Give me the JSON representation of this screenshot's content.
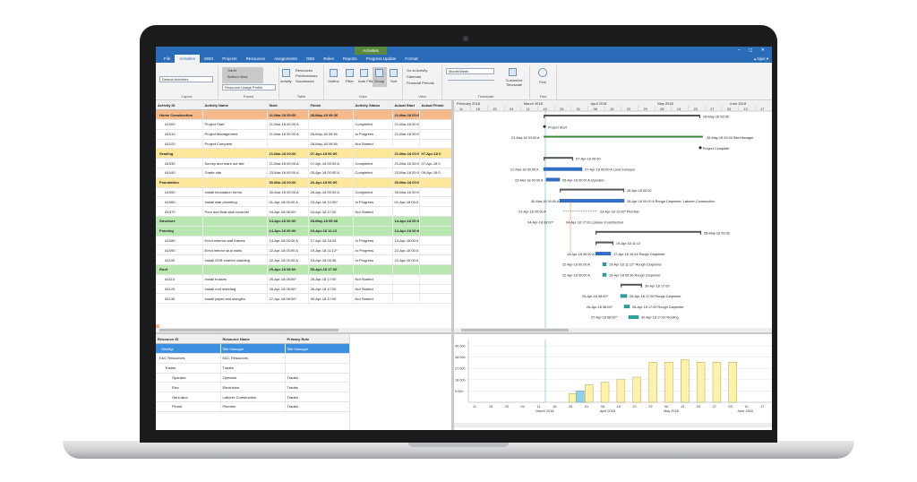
{
  "window": {
    "context_tab": "Activities",
    "controls": "– ◻ ✕"
  },
  "menu": {
    "items": [
      "File",
      "Activities",
      "WBS",
      "Projects",
      "Resources",
      "Assignments",
      "OBS",
      "Roles",
      "Reports",
      "Progress Update",
      "Format"
    ],
    "active": "Activities",
    "right": "▴  Njus ▾"
  },
  "ribbon": {
    "layout": {
      "label": "Layout",
      "value": "Default Activities"
    },
    "panes": {
      "label": "Panes",
      "items": [
        "Gantt",
        "Bottom View",
        "Resource Usage Profile"
      ]
    },
    "table": {
      "label": "Table",
      "activity": "Activity",
      "items": [
        "Resources",
        "Predecessors",
        "Successors"
      ]
    },
    "data": {
      "label": "Data",
      "outline": "Outline",
      "filter": "Filter",
      "auto_filter": "Auto Filter",
      "group": "Group",
      "sort": "Sort"
    },
    "view": {
      "label": "View",
      "items": [
        "Go to Activity",
        "Calendar",
        "Financial Periods"
      ]
    },
    "timescale": {
      "label": "Timescale",
      "value": "Month/Week",
      "customize": "Customize Timescale"
    },
    "find": {
      "label": "Find",
      "button": "Find"
    }
  },
  "activity_table": {
    "columns": [
      "Activity ID",
      "Activity Name",
      "Start",
      "Finish",
      "Activity Status",
      "Actual Start",
      "Actual Finish"
    ],
    "rows": [
      {
        "type": "wbs-orange",
        "cells": [
          "Home Construction",
          "",
          "21-Mar-18 00:00",
          "28-May-18 09:36",
          "",
          "21-Mar-18 00:0",
          ""
        ]
      },
      {
        "type": "task",
        "cells": [
          "A1000",
          "Project Start",
          "21-Mar-18 00:00 A",
          "",
          "Completed",
          "21-Mar-18 00:0",
          ""
        ]
      },
      {
        "type": "task",
        "cells": [
          "A1010",
          "Project Management",
          "21-Mar-18 00:00 A",
          "28-May-18 09:36",
          "In Progress",
          "21-Mar-18 00:0",
          ""
        ]
      },
      {
        "type": "task",
        "cells": [
          "A1020",
          "Project Complete",
          "",
          "28-May-18 09:36",
          "Not Started",
          "",
          ""
        ]
      },
      {
        "type": "wbs-yellow",
        "cells": [
          "Grading",
          "",
          "21-Mar-18 00:00",
          "07-Apr-18 00:00",
          "",
          "21-Mar-18 00:0",
          "07-Apr-18 0"
        ]
      },
      {
        "type": "task",
        "cells": [
          "A1030",
          "Survey and mark out site",
          "21-Mar-18 00:00 A",
          "07-Apr-18 00:00 A",
          "Completed",
          "21-Mar-18 00:0",
          "07-Apr-18 0"
        ]
      },
      {
        "type": "task",
        "cells": [
          "A1040",
          "Grade site",
          "23-Mar-18 00:00 A",
          "05-Apr-18 00:00 A",
          "Completed",
          "23-Mar-18 00:0",
          "05-Apr-18 0"
        ]
      },
      {
        "type": "wbs-yellow",
        "cells": [
          "Foundation",
          "",
          "30-Mar-18 00:00",
          "26-Apr-18 00:00",
          "",
          "30-Mar-18 00:0",
          ""
        ]
      },
      {
        "type": "task",
        "cells": [
          "A1050",
          "Install foundation forms",
          "30-Mar-18 00:00 A",
          "26-Apr-18 00:00 A",
          "Completed",
          "30-Mar-18 00:0",
          ""
        ]
      },
      {
        "type": "task",
        "cells": [
          "A1060",
          "Install slab plumbing",
          "01-Apr-18 00:00 A",
          "23-Apr-18 12:00*",
          "In Progress",
          "01-Apr-18 00:0",
          ""
        ]
      },
      {
        "type": "task",
        "cells": [
          "A1070",
          "Pour and float slab concrete",
          "04-Apr-18 08:00*",
          "04-Apr-18 17:00",
          "Not Started",
          "",
          ""
        ]
      },
      {
        "type": "wbs-green",
        "cells": [
          "Structure",
          "",
          "14-Apr-18 00:00",
          "28-May-18 09:36",
          "",
          "14-Apr-18 00:0",
          ""
        ]
      },
      {
        "type": "wbs-green",
        "cells": [
          "Framing",
          "",
          "14-Apr-18 00:00",
          "19-Apr-18 11:12",
          "",
          "14-Apr-18 00:0",
          ""
        ]
      },
      {
        "type": "task",
        "cells": [
          "A1080",
          "Erect exterior wall frames",
          "14-Apr-18 00:00 A",
          "17-Apr-18 15:24",
          "In Progress",
          "14-Apr-18 00:0",
          ""
        ]
      },
      {
        "type": "task",
        "cells": [
          "A1090",
          "Erect interior stud walls",
          "22-Apr-18 00:00 A",
          "19-Apr-18 11:12*",
          "In Progress",
          "22-Apr-18 00:0",
          ""
        ]
      },
      {
        "type": "task",
        "cells": [
          "A1100",
          "Install OSB exterior cladding",
          "22-Apr-18 00:00 A",
          "19-Apr-18 09:36",
          "In Progress",
          "22-Apr-18 00:0",
          ""
        ]
      },
      {
        "type": "wbs-green",
        "cells": [
          "Roof",
          "",
          "25-Apr-18 08:00",
          "30-Apr-18 17:00",
          "",
          "",
          ""
        ]
      },
      {
        "type": "task",
        "cells": [
          "A1110",
          "Install trusses",
          "25-Apr-18 08:00*",
          "26-Apr-18 17:00",
          "Not Started",
          "",
          ""
        ]
      },
      {
        "type": "task",
        "cells": [
          "A1120",
          "Install roof sheeting",
          "26-Apr-18 08:00*",
          "26-Apr-18 17:00",
          "Not Started",
          "",
          ""
        ]
      },
      {
        "type": "task",
        "cells": [
          "A1130",
          "Install paper and shingles",
          "27-Apr-18 08:00*",
          "30-Apr-18 17:00",
          "Not Started",
          "",
          ""
        ]
      }
    ]
  },
  "gantt": {
    "months": [
      "February 2018",
      "March 2018",
      "April 2018",
      "May 2018",
      "June 2018"
    ],
    "weeks": [
      "11",
      "18",
      "25",
      "04",
      "11",
      "18",
      "25",
      "01",
      "08",
      "15",
      "22",
      "29",
      "06",
      "13",
      "20",
      "27",
      "03",
      "10",
      "17"
    ],
    "labels": [
      {
        "row": 0,
        "text": "28-May-18 09:36"
      },
      {
        "row": 1,
        "text": "Project Start"
      },
      {
        "row": 2,
        "text": "21-Mar-18 00:00 A"
      },
      {
        "row": 2,
        "text": "28-May-18 09:36   Site Manager"
      },
      {
        "row": 3,
        "text": "Project Complete"
      },
      {
        "row": 4,
        "text": "07-Apr-18 00:00"
      },
      {
        "row": 5,
        "text": "21-Mar-18 00:00 A"
      },
      {
        "row": 5,
        "text": "07-Apr-18 00:00 A   Land Surveyor"
      },
      {
        "row": 6,
        "text": "23-Mar-18 00:00 A"
      },
      {
        "row": 6,
        "text": "05-Apr-18 00:00 A   Operator"
      },
      {
        "row": 7,
        "text": "26-Apr-18 00:00"
      },
      {
        "row": 8,
        "text": "30-Mar-18 00:00 A"
      },
      {
        "row": 8,
        "text": "26-Apr-18 00:00 A   Rough Carpenter, Laborer-Construction"
      },
      {
        "row": 9,
        "text": "01-Apr-18 00:00 A"
      },
      {
        "row": 9,
        "text": "23-Apr-18 12:00*   Plumber"
      },
      {
        "row": 10,
        "text": "04-Apr-18 08:00*"
      },
      {
        "row": 10,
        "text": "04-Apr-18 17:00   Laborer-Construction"
      },
      {
        "row": 11,
        "text": "28-May-18 09:36"
      },
      {
        "row": 12,
        "text": "19-Apr-18 11:12"
      },
      {
        "row": 13,
        "text": "14-Apr-18 00:00 A"
      },
      {
        "row": 13,
        "text": "17-Apr-18 15:24   Rough Carpenter"
      },
      {
        "row": 14,
        "text": "22-Apr-18 00:00 A"
      },
      {
        "row": 14,
        "text": "19-Apr-18 11:12*   Rough Carpenter"
      },
      {
        "row": 15,
        "text": "22-Apr-18 00:00 A"
      },
      {
        "row": 15,
        "text": "19-Apr-18 09:36   Rough Carpenter"
      },
      {
        "row": 16,
        "text": "30-Apr-18 17:00"
      },
      {
        "row": 17,
        "text": "25-Apr-18 08:00*"
      },
      {
        "row": 17,
        "text": "26-Apr-18 17:00   Rough Carpenter"
      },
      {
        "row": 18,
        "text": "26-Apr-18 08:00*"
      },
      {
        "row": 18,
        "text": "26-Apr-18 17:00   Rough Carpenter"
      },
      {
        "row": 19,
        "text": "27-Apr-18 08:00*"
      },
      {
        "row": 19,
        "text": "30-Apr-18 17:00   Roofing"
      }
    ]
  },
  "resource_table": {
    "columns": [
      "Resource ID",
      "Resource Name",
      "Primary Role"
    ],
    "rows": [
      {
        "selected": true,
        "cells": [
          "SiteMgr",
          "Site Manager",
          "Site Manager"
        ]
      },
      {
        "selected": false,
        "cells": [
          "E&C Resources",
          "E&C Resources",
          ""
        ]
      },
      {
        "selected": false,
        "cells": [
          "Trades",
          "Trades",
          ""
        ]
      },
      {
        "selected": false,
        "cells": [
          "Operator",
          "Operator",
          "Trades"
        ]
      },
      {
        "selected": false,
        "cells": [
          "Elec",
          "Electrician",
          "Trades"
        ]
      },
      {
        "selected": false,
        "cells": [
          "GenLabor",
          "Laborer-Construction",
          "Trades"
        ]
      },
      {
        "selected": false,
        "cells": [
          "Plumb",
          "Plumber",
          "Trades"
        ]
      }
    ]
  },
  "histogram": {
    "y_ticks": [
      "45.00h",
      "36.00h",
      "27.00h",
      "18.00h",
      "9.00h"
    ],
    "months": [
      "March 2018",
      "April 2018",
      "May 2018",
      "June 2018"
    ],
    "weeks": [
      "11",
      "18",
      "25",
      "04",
      "11",
      "18",
      "25",
      "01",
      "08",
      "15",
      "22",
      "29",
      "06",
      "13",
      "20",
      "27",
      "03",
      "10",
      "17"
    ]
  },
  "chart_data": {
    "type": "bar",
    "title": "",
    "ylabel": "",
    "ylim": [
      0,
      50
    ],
    "categories": [
      "18",
      "25",
      "01",
      "08",
      "15",
      "22",
      "29",
      "06",
      "13",
      "20",
      "27"
    ],
    "series": [
      {
        "values": [
          0,
          0,
          7,
          14,
          16,
          18,
          20,
          32,
          32,
          34,
          32,
          32,
          32
        ]
      },
      {
        "values": [
          0,
          0,
          0,
          9,
          0,
          0,
          0,
          0,
          0,
          0,
          0,
          0,
          0
        ]
      }
    ],
    "colors": [
      "#fdf2a8",
      "#8fd0ea"
    ]
  }
}
